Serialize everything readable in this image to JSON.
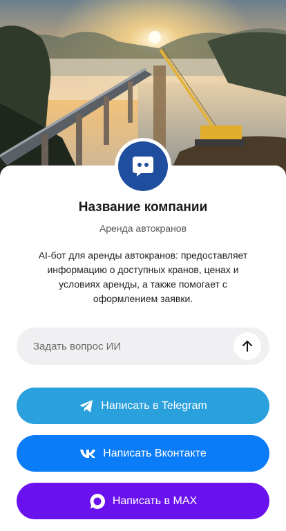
{
  "hero": {
    "image": "sunset-bridge-construction-crane-photo"
  },
  "profile": {
    "avatar_icon": "chat-bot-icon",
    "company_name": "Название компании",
    "category": "Аренда автокранов",
    "description": "AI-бот для аренды автокранов: предоставляет информацию о доступных кранов, ценах и условиях аренды, а также помогает с оформлением заявки."
  },
  "ask": {
    "placeholder": "Задать вопрос ИИ",
    "value": "",
    "send_icon": "arrow-up-icon"
  },
  "buttons": [
    {
      "label": "Написать в Telegram",
      "icon": "telegram-icon",
      "color": "#2aa0dd"
    },
    {
      "label": "Написать Вконтакте",
      "icon": "vk-icon",
      "color": "#0a7cf8"
    },
    {
      "label": "Написать в MAX",
      "icon": "max-icon",
      "color": "#6a12ee"
    }
  ],
  "colors": {
    "avatar_bg": "#1f4e9f",
    "ask_bg": "#f0f0f2"
  }
}
